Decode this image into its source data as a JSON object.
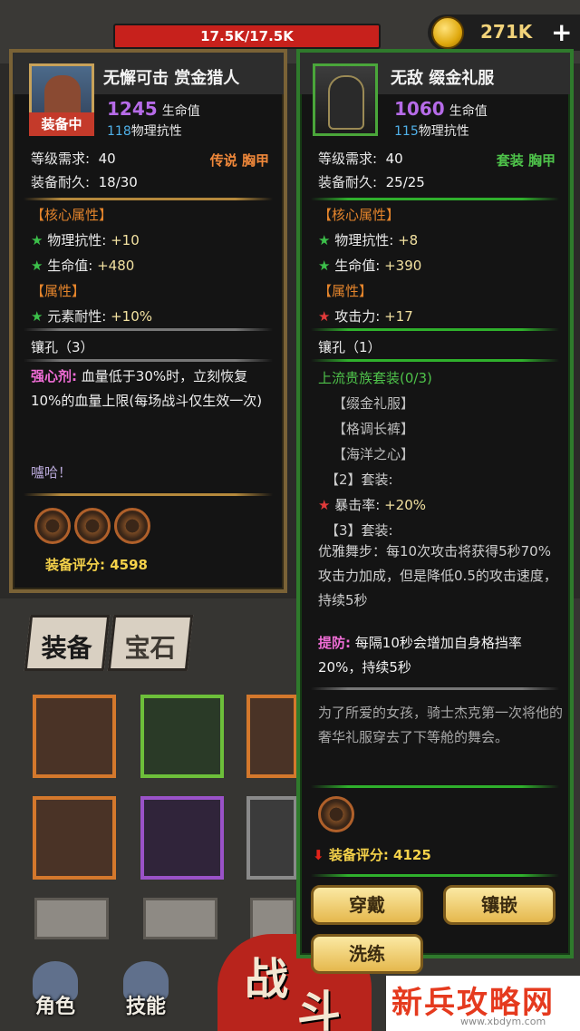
{
  "hud": {
    "hp": "17.5K/17.5K",
    "coins": "271K",
    "add_label": "+"
  },
  "left_item": {
    "name": "无懈可击 赏金猎人",
    "equipped_badge": "装备中",
    "hp_value": "1245",
    "hp_unit": "生命值",
    "armor_value": "118",
    "armor_unit": "物理抗性",
    "level_label": "等级需求:",
    "level_value": "40",
    "rarity": "传说 胸甲",
    "durability_label": "装备耐久:",
    "durability_value": "18/30",
    "core_title": "【核心属性】",
    "core_stats": [
      {
        "star": "★",
        "name": "物理抗性:",
        "value": "+10"
      },
      {
        "star": "★",
        "name": "生命值:",
        "value": "+480"
      }
    ],
    "attr_title": "【属性】",
    "attr_stats": [
      {
        "star": "★",
        "name": "元素耐性:",
        "value": "+10%"
      }
    ],
    "sockets_label": "镶孔（3）",
    "skill_name": "强心剂:",
    "skill_text": "血量低于30%时，立刻恢复10%的血量上限(每场战斗仅生效一次)",
    "quote": "嚧哈！",
    "score_label": "装备评分:",
    "score_value": "4598"
  },
  "right_item": {
    "name": "无敌 缀金礼服",
    "hp_value": "1060",
    "hp_unit": "生命值",
    "armor_value": "115",
    "armor_unit": "物理抗性",
    "level_label": "等级需求:",
    "level_value": "40",
    "rarity": "套装 胸甲",
    "durability_label": "装备耐久:",
    "durability_value": "25/25",
    "core_title": "【核心属性】",
    "core_stats": [
      {
        "star": "★",
        "name": "物理抗性:",
        "value": "+8"
      },
      {
        "star": "★",
        "name": "生命值:",
        "value": "+390"
      }
    ],
    "attr_title": "【属性】",
    "attr_stats": [
      {
        "star": "★",
        "name": "攻击力:",
        "value": "+17"
      }
    ],
    "sockets_label": "镶孔（1）",
    "set_title": "上流贵族套装(0/3)",
    "set_pieces": [
      "【缀金礼服】",
      "【格调长裤】",
      "【海洋之心】"
    ],
    "set_tier2": "【2】套装:",
    "set_tier2_stat": {
      "star": "★",
      "name": "暴击率:",
      "value": "+20%"
    },
    "set_tier3": "【3】套装:",
    "set_tier3_text": "优雅舞步：每10次攻击将获得5秒70%攻击力加成，但是降低0.5的攻击速度，持续5秒",
    "skill_name": "提防:",
    "skill_text": "每隔10秒会增加自身格挡率20%，持续5秒",
    "lore": "为了所爱的女孩，骑士杰克第一次将他的奢华礼服穿去了下等舱的舞会。",
    "score_arrow": "⬇",
    "score_label": "装备评分:",
    "score_value": "4125",
    "buttons": {
      "wear": "穿戴",
      "inlay": "镶嵌",
      "wash": "洗练"
    }
  },
  "tabs": {
    "equip": "装备",
    "gem": "宝石"
  },
  "bottom_nav": {
    "character": "角色",
    "skills": "技能",
    "battle_1": "战",
    "battle_2": "斗"
  },
  "watermark": {
    "title": "新兵攻略网",
    "url": "www.xbdym.com"
  }
}
